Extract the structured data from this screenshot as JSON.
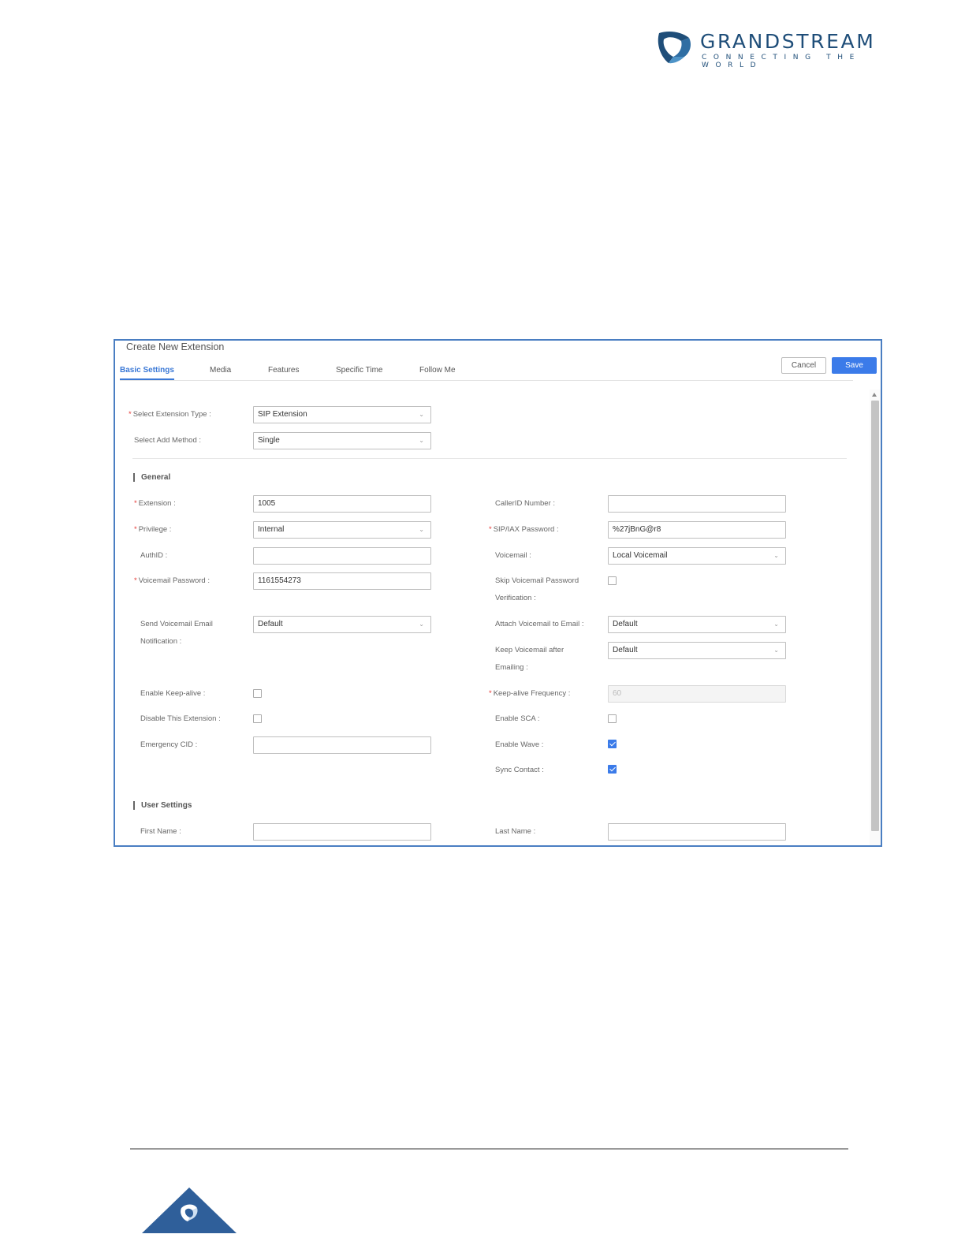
{
  "header": {
    "brand": "GRANDSTREAM",
    "tagline": "CONNECTING THE WORLD",
    "colors": {
      "brand": "#1f4e79",
      "accent": "#3b7be9"
    }
  },
  "dialog": {
    "title": "Create New Extension",
    "tabs": [
      "Basic Settings",
      "Media",
      "Features",
      "Specific Time",
      "Follow Me"
    ],
    "active_tab": "Basic Settings",
    "cancel_label": "Cancel",
    "save_label": "Save"
  },
  "top": {
    "extension_type_label": "Select Extension Type :",
    "extension_type_value": "SIP Extension",
    "add_method_label": "Select Add Method :",
    "add_method_value": "Single"
  },
  "general": {
    "title": "General",
    "extension_label": "Extension :",
    "extension_value": "1005",
    "callerid_label": "CallerID Number :",
    "callerid_value": "",
    "privilege_label": "Privilege :",
    "privilege_value": "Internal",
    "sip_password_label": "SIP/IAX Password :",
    "sip_password_value": "%27jBnG@r8",
    "authid_label": "AuthID :",
    "authid_value": "",
    "voicemail_label": "Voicemail :",
    "voicemail_value": "Local Voicemail",
    "vm_password_label": "Voicemail Password :",
    "vm_password_value": "1161554273",
    "skip_vm_label_1": "Skip Voicemail Password",
    "skip_vm_label_2": "Verification :",
    "send_vm_label_1": "Send Voicemail Email",
    "send_vm_label_2": "Notification :",
    "send_vm_value": "Default",
    "attach_vm_label": "Attach Voicemail to Email :",
    "attach_vm_value": "Default",
    "keep_vm_label_1": "Keep Voicemail after",
    "keep_vm_label_2": "Emailing :",
    "keep_vm_value": "Default",
    "keepalive_label": "Enable Keep-alive :",
    "keepalive_freq_label": "Keep-alive Frequency :",
    "keepalive_freq_value": "60",
    "disable_ext_label": "Disable This Extension :",
    "enable_sca_label": "Enable SCA :",
    "emergency_cid_label": "Emergency CID :",
    "emergency_cid_value": "",
    "enable_wave_label": "Enable Wave :",
    "sync_contact_label": "Sync Contact :",
    "checkbox_states": {
      "skip_vm": false,
      "keepalive": false,
      "disable_ext": false,
      "enable_sca": false,
      "enable_wave": true,
      "sync_contact": true
    }
  },
  "user_settings": {
    "title": "User Settings",
    "first_name_label": "First Name :",
    "first_name_value": "",
    "last_name_label": "Last Name :",
    "last_name_value": ""
  }
}
